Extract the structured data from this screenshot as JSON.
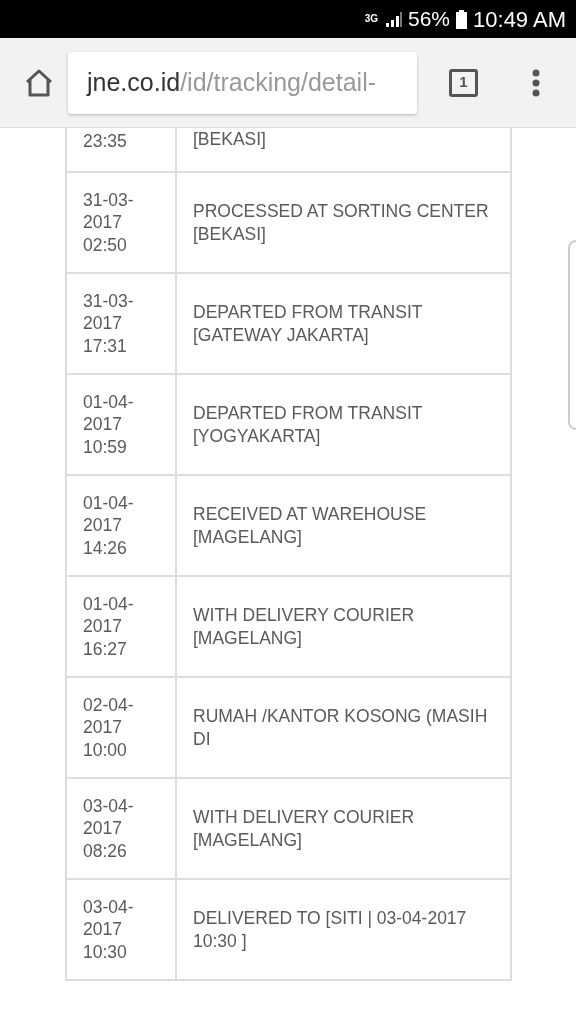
{
  "status_bar": {
    "network": "3G",
    "battery": "56%",
    "time": "10:49 AM"
  },
  "browser": {
    "url_host": "jne.co.id",
    "url_path": "/id/tracking/detail-",
    "tab_count": "1"
  },
  "rows": [
    {
      "date": "23:35",
      "description": "[BEKASI]",
      "kind": "partial"
    },
    {
      "date": "31-03-2017 02:50",
      "description": "PROCESSED AT SORTING CENTER [BEKASI]",
      "kind": "full"
    },
    {
      "date": "31-03-2017 17:31",
      "description": "DEPARTED FROM TRANSIT [GATEWAY JAKARTA]",
      "kind": "full"
    },
    {
      "date": "01-04-2017 10:59",
      "description": "DEPARTED FROM TRANSIT [YOGYAKARTA]",
      "kind": "full"
    },
    {
      "date": "01-04-2017 14:26",
      "description": "RECEIVED AT WAREHOUSE [MAGELANG]",
      "kind": "full"
    },
    {
      "date": "01-04-2017 16:27",
      "description": "WITH DELIVERY COURIER [MAGELANG]",
      "kind": "full"
    },
    {
      "date": "02-04-2017 10:00",
      "description": "RUMAH /KANTOR KOSONG (MASIH DI",
      "kind": "full"
    },
    {
      "date": "03-04-2017 08:26",
      "description": "WITH DELIVERY COURIER [MAGELANG]",
      "kind": "full"
    },
    {
      "date": "03-04-2017 10:30",
      "description": "DELIVERED TO [SITI | 03-04-2017 10:30 ]",
      "kind": "full"
    }
  ]
}
